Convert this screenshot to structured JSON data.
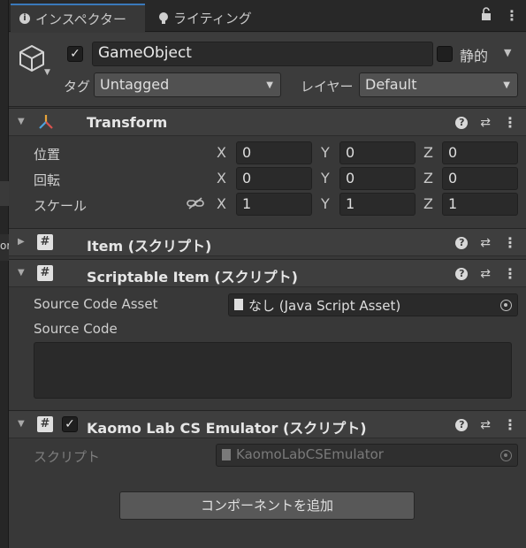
{
  "tabs": [
    {
      "label": "インスペクター",
      "icon": "info-icon"
    },
    {
      "label": "ライティング",
      "icon": "lightbulb-icon"
    }
  ],
  "tab_tools": {
    "lock": "lock-icon",
    "menu": "kebab-menu-icon"
  },
  "header": {
    "active_checked": "✓",
    "object_name": "GameObject",
    "static_label": "静的",
    "tag_label": "タグ",
    "tag_value": "Untagged",
    "layer_label": "レイヤー",
    "layer_value": "Default"
  },
  "transform": {
    "title": "Transform",
    "position_label": "位置",
    "rotation_label": "回転",
    "scale_label": "スケール",
    "axis_x": "X",
    "axis_y": "Y",
    "axis_z": "Z",
    "position": [
      "0",
      "0",
      "0"
    ],
    "rotation": [
      "0",
      "0",
      "0"
    ],
    "scale": [
      "1",
      "1",
      "1"
    ]
  },
  "item": {
    "title": "Item (スクリプト)"
  },
  "scriptable_item": {
    "title": "Scriptable Item (スクリプト)",
    "source_code_asset_label": "Source Code Asset",
    "source_code_asset_value": "なし (Java Script Asset)",
    "source_code_label": "Source Code"
  },
  "emulator": {
    "title": "Kaomo Lab CS Emulator (スクリプト)",
    "enabled_checked": "✓",
    "script_label": "スクリプト",
    "script_value": "KaomoLabCSEmulator"
  },
  "add_component_label": "コンポーネントを追加",
  "left_strip_text": "or",
  "colors": {
    "accent": "#3a79bb",
    "panel": "#383838",
    "field": "#2a2a2a"
  }
}
